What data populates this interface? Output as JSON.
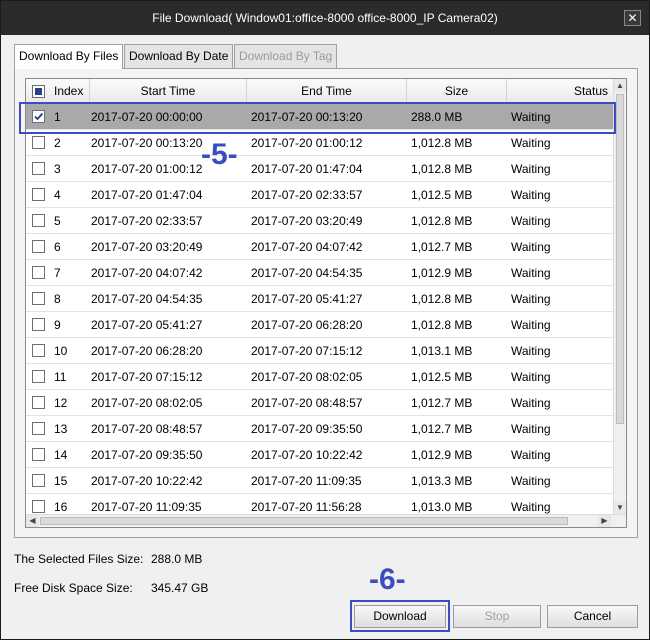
{
  "window": {
    "title": "File Download( Window01:office-8000 office-8000_IP Camera02)",
    "close_glyph": "✕"
  },
  "tabs": [
    {
      "label": "Download By Files",
      "active": true,
      "enabled": true
    },
    {
      "label": "Download By Date",
      "active": false,
      "enabled": true
    },
    {
      "label": "Download By Tag",
      "active": false,
      "enabled": false
    }
  ],
  "table": {
    "columns": [
      "Index",
      "Start Time",
      "End Time",
      "Size",
      "Status"
    ],
    "header_checkbox_state": "partial",
    "rows": [
      {
        "index": "1",
        "start": "2017-07-20 00:00:00",
        "end": "2017-07-20 00:13:20",
        "size": "288.0 MB",
        "status": "Waiting",
        "checked": true,
        "selected": true
      },
      {
        "index": "2",
        "start": "2017-07-20 00:13:20",
        "end": "2017-07-20 01:00:12",
        "size": "1,012.8 MB",
        "status": "Waiting",
        "checked": false,
        "selected": false
      },
      {
        "index": "3",
        "start": "2017-07-20 01:00:12",
        "end": "2017-07-20 01:47:04",
        "size": "1,012.8 MB",
        "status": "Waiting",
        "checked": false,
        "selected": false
      },
      {
        "index": "4",
        "start": "2017-07-20 01:47:04",
        "end": "2017-07-20 02:33:57",
        "size": "1,012.5 MB",
        "status": "Waiting",
        "checked": false,
        "selected": false
      },
      {
        "index": "5",
        "start": "2017-07-20 02:33:57",
        "end": "2017-07-20 03:20:49",
        "size": "1,012.8 MB",
        "status": "Waiting",
        "checked": false,
        "selected": false
      },
      {
        "index": "6",
        "start": "2017-07-20 03:20:49",
        "end": "2017-07-20 04:07:42",
        "size": "1,012.7 MB",
        "status": "Waiting",
        "checked": false,
        "selected": false
      },
      {
        "index": "7",
        "start": "2017-07-20 04:07:42",
        "end": "2017-07-20 04:54:35",
        "size": "1,012.9 MB",
        "status": "Waiting",
        "checked": false,
        "selected": false
      },
      {
        "index": "8",
        "start": "2017-07-20 04:54:35",
        "end": "2017-07-20 05:41:27",
        "size": "1,012.8 MB",
        "status": "Waiting",
        "checked": false,
        "selected": false
      },
      {
        "index": "9",
        "start": "2017-07-20 05:41:27",
        "end": "2017-07-20 06:28:20",
        "size": "1,012.8 MB",
        "status": "Waiting",
        "checked": false,
        "selected": false
      },
      {
        "index": "10",
        "start": "2017-07-20 06:28:20",
        "end": "2017-07-20 07:15:12",
        "size": "1,013.1 MB",
        "status": "Waiting",
        "checked": false,
        "selected": false
      },
      {
        "index": "11",
        "start": "2017-07-20 07:15:12",
        "end": "2017-07-20 08:02:05",
        "size": "1,012.5 MB",
        "status": "Waiting",
        "checked": false,
        "selected": false
      },
      {
        "index": "12",
        "start": "2017-07-20 08:02:05",
        "end": "2017-07-20 08:48:57",
        "size": "1,012.7 MB",
        "status": "Waiting",
        "checked": false,
        "selected": false
      },
      {
        "index": "13",
        "start": "2017-07-20 08:48:57",
        "end": "2017-07-20 09:35:50",
        "size": "1,012.7 MB",
        "status": "Waiting",
        "checked": false,
        "selected": false
      },
      {
        "index": "14",
        "start": "2017-07-20 09:35:50",
        "end": "2017-07-20 10:22:42",
        "size": "1,012.9 MB",
        "status": "Waiting",
        "checked": false,
        "selected": false
      },
      {
        "index": "15",
        "start": "2017-07-20 10:22:42",
        "end": "2017-07-20 11:09:35",
        "size": "1,013.3 MB",
        "status": "Waiting",
        "checked": false,
        "selected": false
      },
      {
        "index": "16",
        "start": "2017-07-20 11:09:35",
        "end": "2017-07-20 11:56:28",
        "size": "1,013.0 MB",
        "status": "Waiting",
        "checked": false,
        "selected": false
      }
    ]
  },
  "summary": {
    "selected_size_label": "The Selected Files Size:",
    "selected_size_value": "288.0 MB",
    "free_space_label": "Free Disk Space Size:",
    "free_space_value": "345.47 GB"
  },
  "buttons": {
    "download": "Download",
    "stop": "Stop",
    "cancel": "Cancel"
  },
  "callouts": {
    "row_marker": "-5-",
    "button_marker": "-6-",
    "color": "#3a4ec2"
  },
  "scroll_arrows": {
    "up": "▲",
    "down": "▼",
    "left": "◀",
    "right": "▶"
  }
}
